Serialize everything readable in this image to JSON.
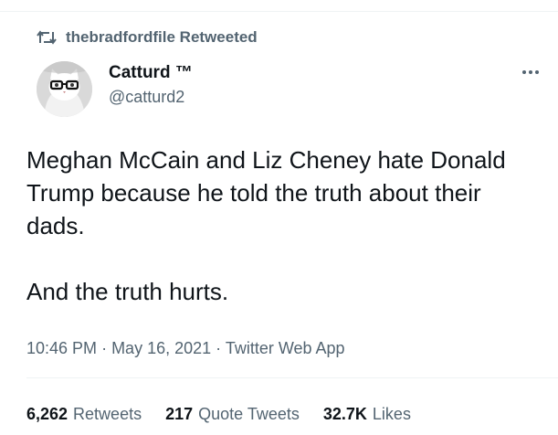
{
  "retweet_context": {
    "text": "thebradfordfile Retweeted",
    "icon": "retweet-icon"
  },
  "author": {
    "display_name": "Catturd ™",
    "handle": "@catturd2",
    "avatar": "cat-with-glasses-avatar"
  },
  "more_menu": {
    "icon": "more-horizontal-icon"
  },
  "tweet": {
    "paragraph_1": "Meghan McCain and Liz Cheney hate Donald Trump because he told the truth about their dads.",
    "paragraph_2": "And the truth hurts."
  },
  "meta": {
    "time": "10:46 PM",
    "date": "May 16, 2021",
    "source": "Twitter Web App",
    "separator": "·"
  },
  "stats": {
    "retweets_count": "6,262",
    "retweets_label": "Retweets",
    "quote_tweets_count": "217",
    "quote_tweets_label": "Quote Tweets",
    "likes_count": "32.7K",
    "likes_label": "Likes"
  },
  "colors": {
    "primary_text": "#0f1419",
    "secondary_text": "#536471",
    "divider": "#eff3f4"
  }
}
